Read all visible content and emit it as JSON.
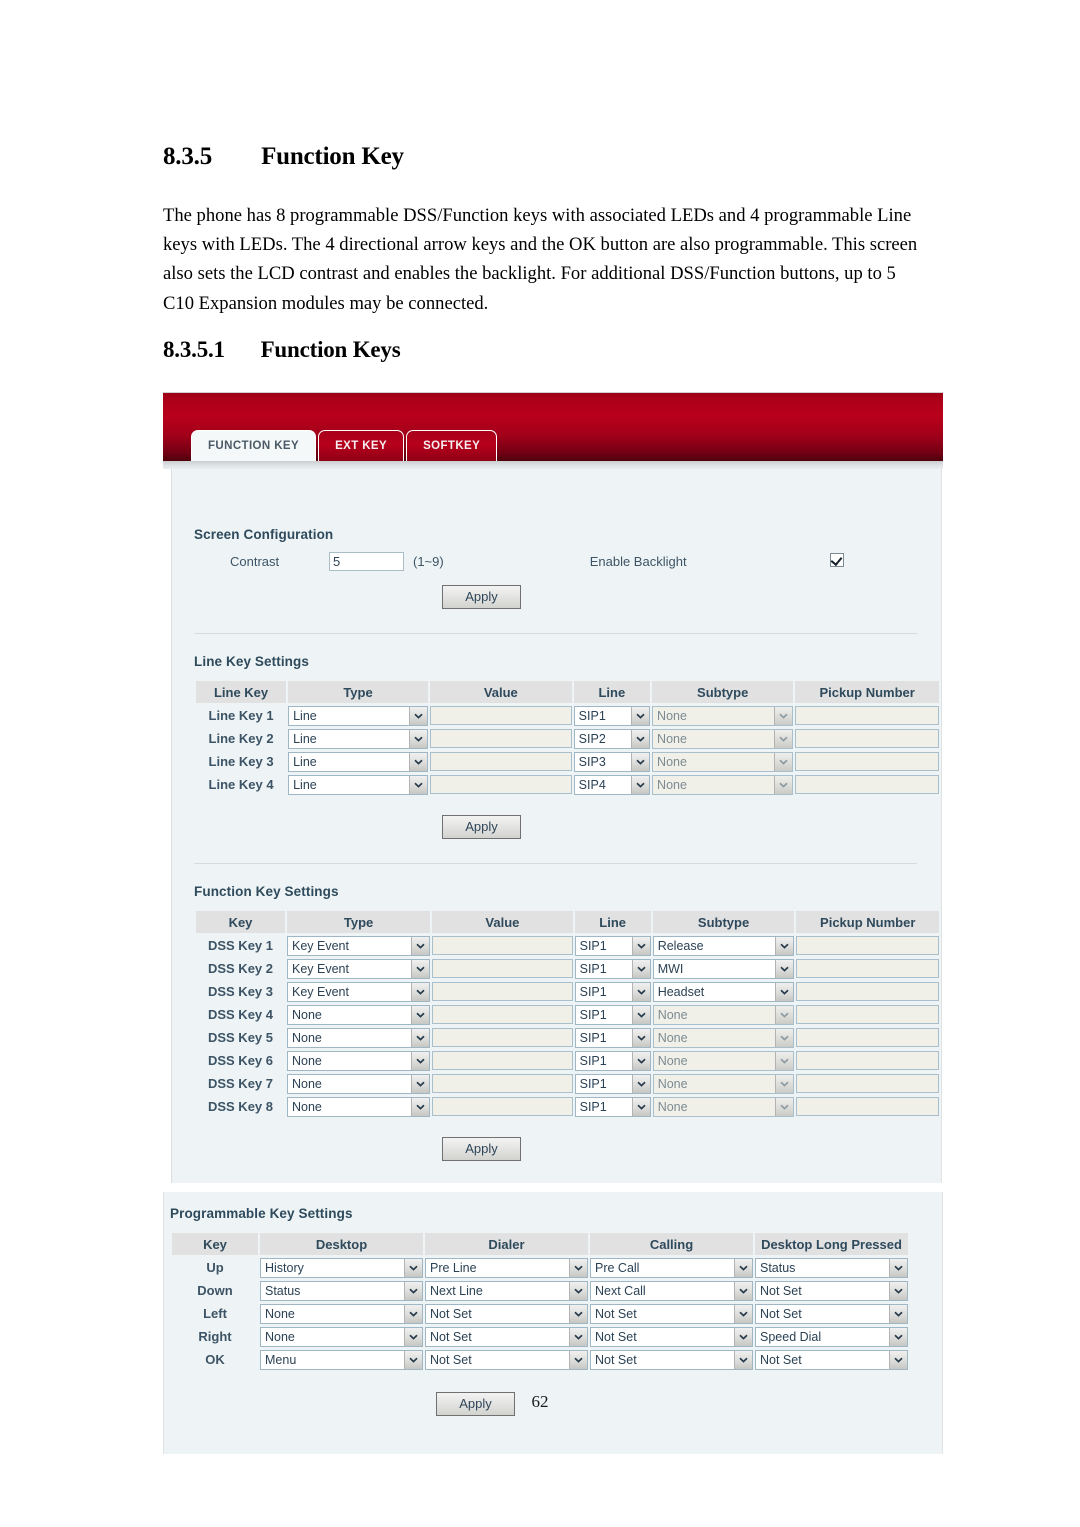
{
  "document": {
    "section_number": "8.3.5",
    "section_title": "Function Key",
    "body": "The phone has 8 programmable DSS/Function keys with associated LEDs and 4 programmable Line keys with LEDs. The 4 directional arrow keys and the OK button are also programmable. This screen also sets the LCD contrast and enables the backlight.    For additional DSS/Function buttons, up to 5 C10 Expansion modules may be connected.",
    "subsection_number": "8.3.5.1",
    "subsection_title": "Function Keys",
    "page_number": "62"
  },
  "colors": {
    "header_red": "#b9001b",
    "header_red_dark": "#4d000c",
    "panel_bg": "#eef4f5",
    "table_header": "#e1e1e1",
    "label_text": "#2e4a5c",
    "readonly_field": "#f1f0e8"
  },
  "webui": {
    "tabs": [
      {
        "label": "FUNCTION KEY",
        "active": true
      },
      {
        "label": "EXT KEY",
        "active": false
      },
      {
        "label": "SOFTKEY",
        "active": false
      }
    ],
    "screen_configuration": {
      "title": "Screen Configuration",
      "contrast_label": "Contrast",
      "contrast_value": "5",
      "contrast_range": "(1~9)",
      "backlight_label": "Enable Backlight",
      "backlight_checked": true,
      "apply_label": "Apply"
    },
    "line_key_settings": {
      "title": "Line Key Settings",
      "headers": [
        "Line Key",
        "Type",
        "Value",
        "Line",
        "Subtype",
        "Pickup Number"
      ],
      "rows": [
        {
          "key": "Line Key 1",
          "type": "Line",
          "value": "",
          "line": "SIP1",
          "subtype": "None",
          "subtype_disabled": true,
          "pickup": ""
        },
        {
          "key": "Line Key 2",
          "type": "Line",
          "value": "",
          "line": "SIP2",
          "subtype": "None",
          "subtype_disabled": true,
          "pickup": ""
        },
        {
          "key": "Line Key 3",
          "type": "Line",
          "value": "",
          "line": "SIP3",
          "subtype": "None",
          "subtype_disabled": true,
          "pickup": ""
        },
        {
          "key": "Line Key 4",
          "type": "Line",
          "value": "",
          "line": "SIP4",
          "subtype": "None",
          "subtype_disabled": true,
          "pickup": ""
        }
      ],
      "apply_label": "Apply"
    },
    "function_key_settings": {
      "title": "Function Key Settings",
      "headers": [
        "Key",
        "Type",
        "Value",
        "Line",
        "Subtype",
        "Pickup Number"
      ],
      "rows": [
        {
          "key": "DSS Key 1",
          "type": "Key Event",
          "value": "",
          "line": "SIP1",
          "subtype": "Release",
          "subtype_disabled": false,
          "pickup": ""
        },
        {
          "key": "DSS Key 2",
          "type": "Key Event",
          "value": "",
          "line": "SIP1",
          "subtype": "MWI",
          "subtype_disabled": false,
          "pickup": ""
        },
        {
          "key": "DSS Key 3",
          "type": "Key Event",
          "value": "",
          "line": "SIP1",
          "subtype": "Headset",
          "subtype_disabled": false,
          "pickup": ""
        },
        {
          "key": "DSS Key 4",
          "type": "None",
          "value": "",
          "line": "SIP1",
          "subtype": "None",
          "subtype_disabled": true,
          "pickup": ""
        },
        {
          "key": "DSS Key 5",
          "type": "None",
          "value": "",
          "line": "SIP1",
          "subtype": "None",
          "subtype_disabled": true,
          "pickup": ""
        },
        {
          "key": "DSS Key 6",
          "type": "None",
          "value": "",
          "line": "SIP1",
          "subtype": "None",
          "subtype_disabled": true,
          "pickup": ""
        },
        {
          "key": "DSS Key 7",
          "type": "None",
          "value": "",
          "line": "SIP1",
          "subtype": "None",
          "subtype_disabled": true,
          "pickup": ""
        },
        {
          "key": "DSS Key 8",
          "type": "None",
          "value": "",
          "line": "SIP1",
          "subtype": "None",
          "subtype_disabled": true,
          "pickup": ""
        }
      ],
      "apply_label": "Apply"
    },
    "programmable_key_settings": {
      "title": "Programmable Key Settings",
      "headers": [
        "Key",
        "Desktop",
        "Dialer",
        "Calling",
        "Desktop Long Pressed"
      ],
      "rows": [
        {
          "key": "Up",
          "desktop": "History",
          "dialer": "Pre Line",
          "calling": "Pre Call",
          "long_pressed": "Status"
        },
        {
          "key": "Down",
          "desktop": "Status",
          "dialer": "Next Line",
          "calling": "Next Call",
          "long_pressed": "Not Set"
        },
        {
          "key": "Left",
          "desktop": "None",
          "dialer": "Not Set",
          "calling": "Not Set",
          "long_pressed": "Not Set"
        },
        {
          "key": "Right",
          "desktop": "None",
          "dialer": "Not Set",
          "calling": "Not Set",
          "long_pressed": "Speed Dial"
        },
        {
          "key": "OK",
          "desktop": "Menu",
          "dialer": "Not Set",
          "calling": "Not Set",
          "long_pressed": "Not Set"
        }
      ],
      "apply_label": "Apply"
    }
  }
}
